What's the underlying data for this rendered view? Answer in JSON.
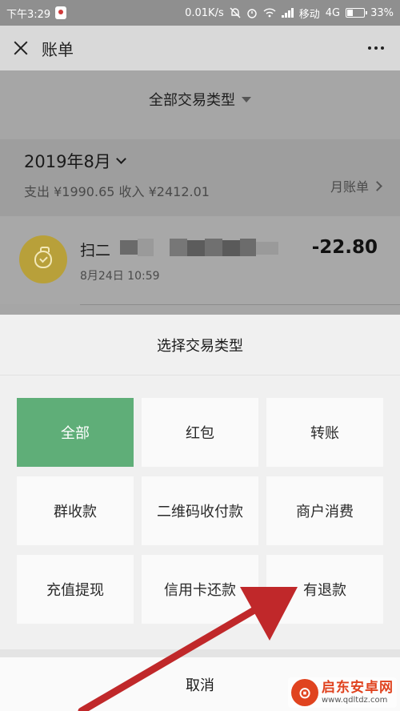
{
  "status_bar": {
    "time": "下午3:29",
    "speed": "0.01K/s",
    "carrier": "移动",
    "network": "4G",
    "battery": "33%",
    "battery_level": 0.33
  },
  "nav": {
    "title": "账单",
    "close_icon": "close-icon",
    "more_icon": "more-icon"
  },
  "filter": {
    "label": "全部交易类型"
  },
  "month": {
    "title": "2019年8月",
    "summary": "支出 ¥1990.65 收入 ¥2412.01",
    "bill_link": "月账单"
  },
  "transaction": {
    "name": "扫二",
    "date": "8月24日 10:59",
    "amount": "-22.80",
    "icon": "payment-bag-icon"
  },
  "sheet": {
    "title": "选择交易类型",
    "options": [
      {
        "label": "全部",
        "active": true
      },
      {
        "label": "红包"
      },
      {
        "label": "转账"
      },
      {
        "label": "群收款"
      },
      {
        "label": "二维码收付款"
      },
      {
        "label": "商户消费"
      },
      {
        "label": "充值提现"
      },
      {
        "label": "信用卡还款"
      },
      {
        "label": "有退款"
      }
    ],
    "cancel": "取消"
  },
  "colors": {
    "active_option": "#5fae78",
    "annotation_arrow": "#c0282a",
    "icon_gold": "#b8a03a"
  },
  "watermark": {
    "name": "启东安卓网",
    "url": "www.qdltdz.com"
  }
}
